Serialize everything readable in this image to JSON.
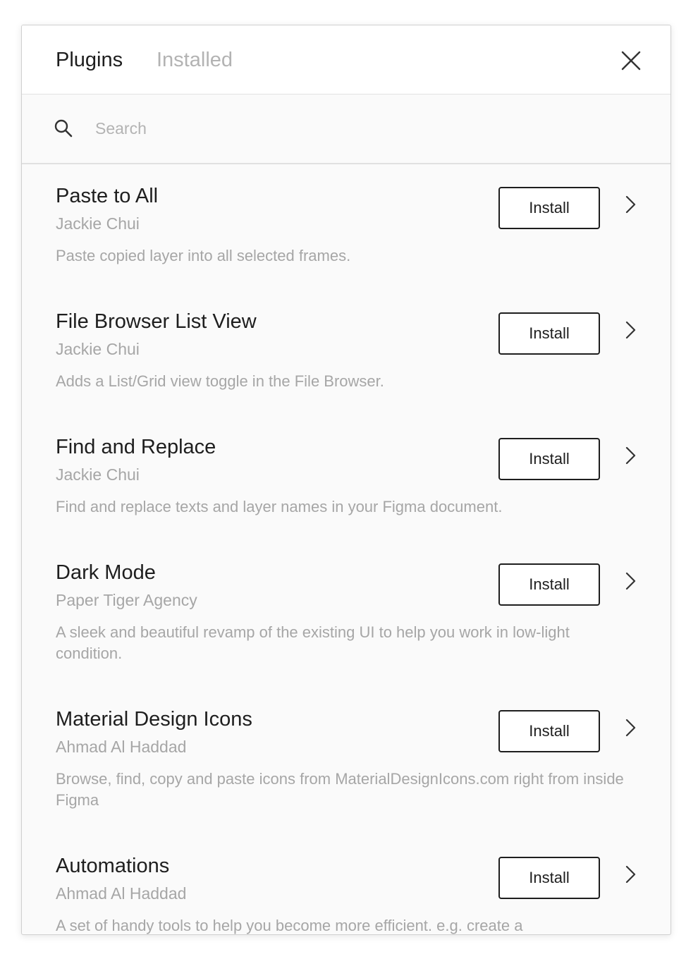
{
  "header": {
    "tabs": [
      {
        "label": "Plugins",
        "active": true
      },
      {
        "label": "Installed",
        "active": false
      }
    ],
    "close_icon": "close-icon"
  },
  "search": {
    "icon": "search-icon",
    "placeholder": "Search",
    "value": ""
  },
  "plugins": [
    {
      "title": "Paste to All",
      "author": "Jackie Chui",
      "description": "Paste copied layer into all selected frames.",
      "action_label": "Install"
    },
    {
      "title": "File Browser List View",
      "author": "Jackie Chui",
      "description": "Adds a List/Grid view toggle in the File Browser.",
      "action_label": "Install"
    },
    {
      "title": "Find and Replace",
      "author": "Jackie Chui",
      "description": "Find and replace texts and layer names in your Figma document.",
      "action_label": "Install"
    },
    {
      "title": "Dark Mode",
      "author": "Paper Tiger Agency",
      "description": "A sleek and beautiful revamp of the existing UI to help you work in low-light condition.",
      "action_label": "Install"
    },
    {
      "title": "Material Design Icons",
      "author": "Ahmad Al Haddad",
      "description": "Browse, find, copy and paste icons from MaterialDesignIcons.com right from inside Figma",
      "action_label": "Install"
    },
    {
      "title": "Automations",
      "author": "Ahmad Al Haddad",
      "description": "A set of handy tools to help you become more efficient. e.g. create a",
      "action_label": "Install"
    }
  ],
  "colors": {
    "text_primary": "#1e1e1e",
    "text_secondary": "#a6a6a6",
    "background": "#fafafa",
    "header_background": "#ffffff"
  }
}
